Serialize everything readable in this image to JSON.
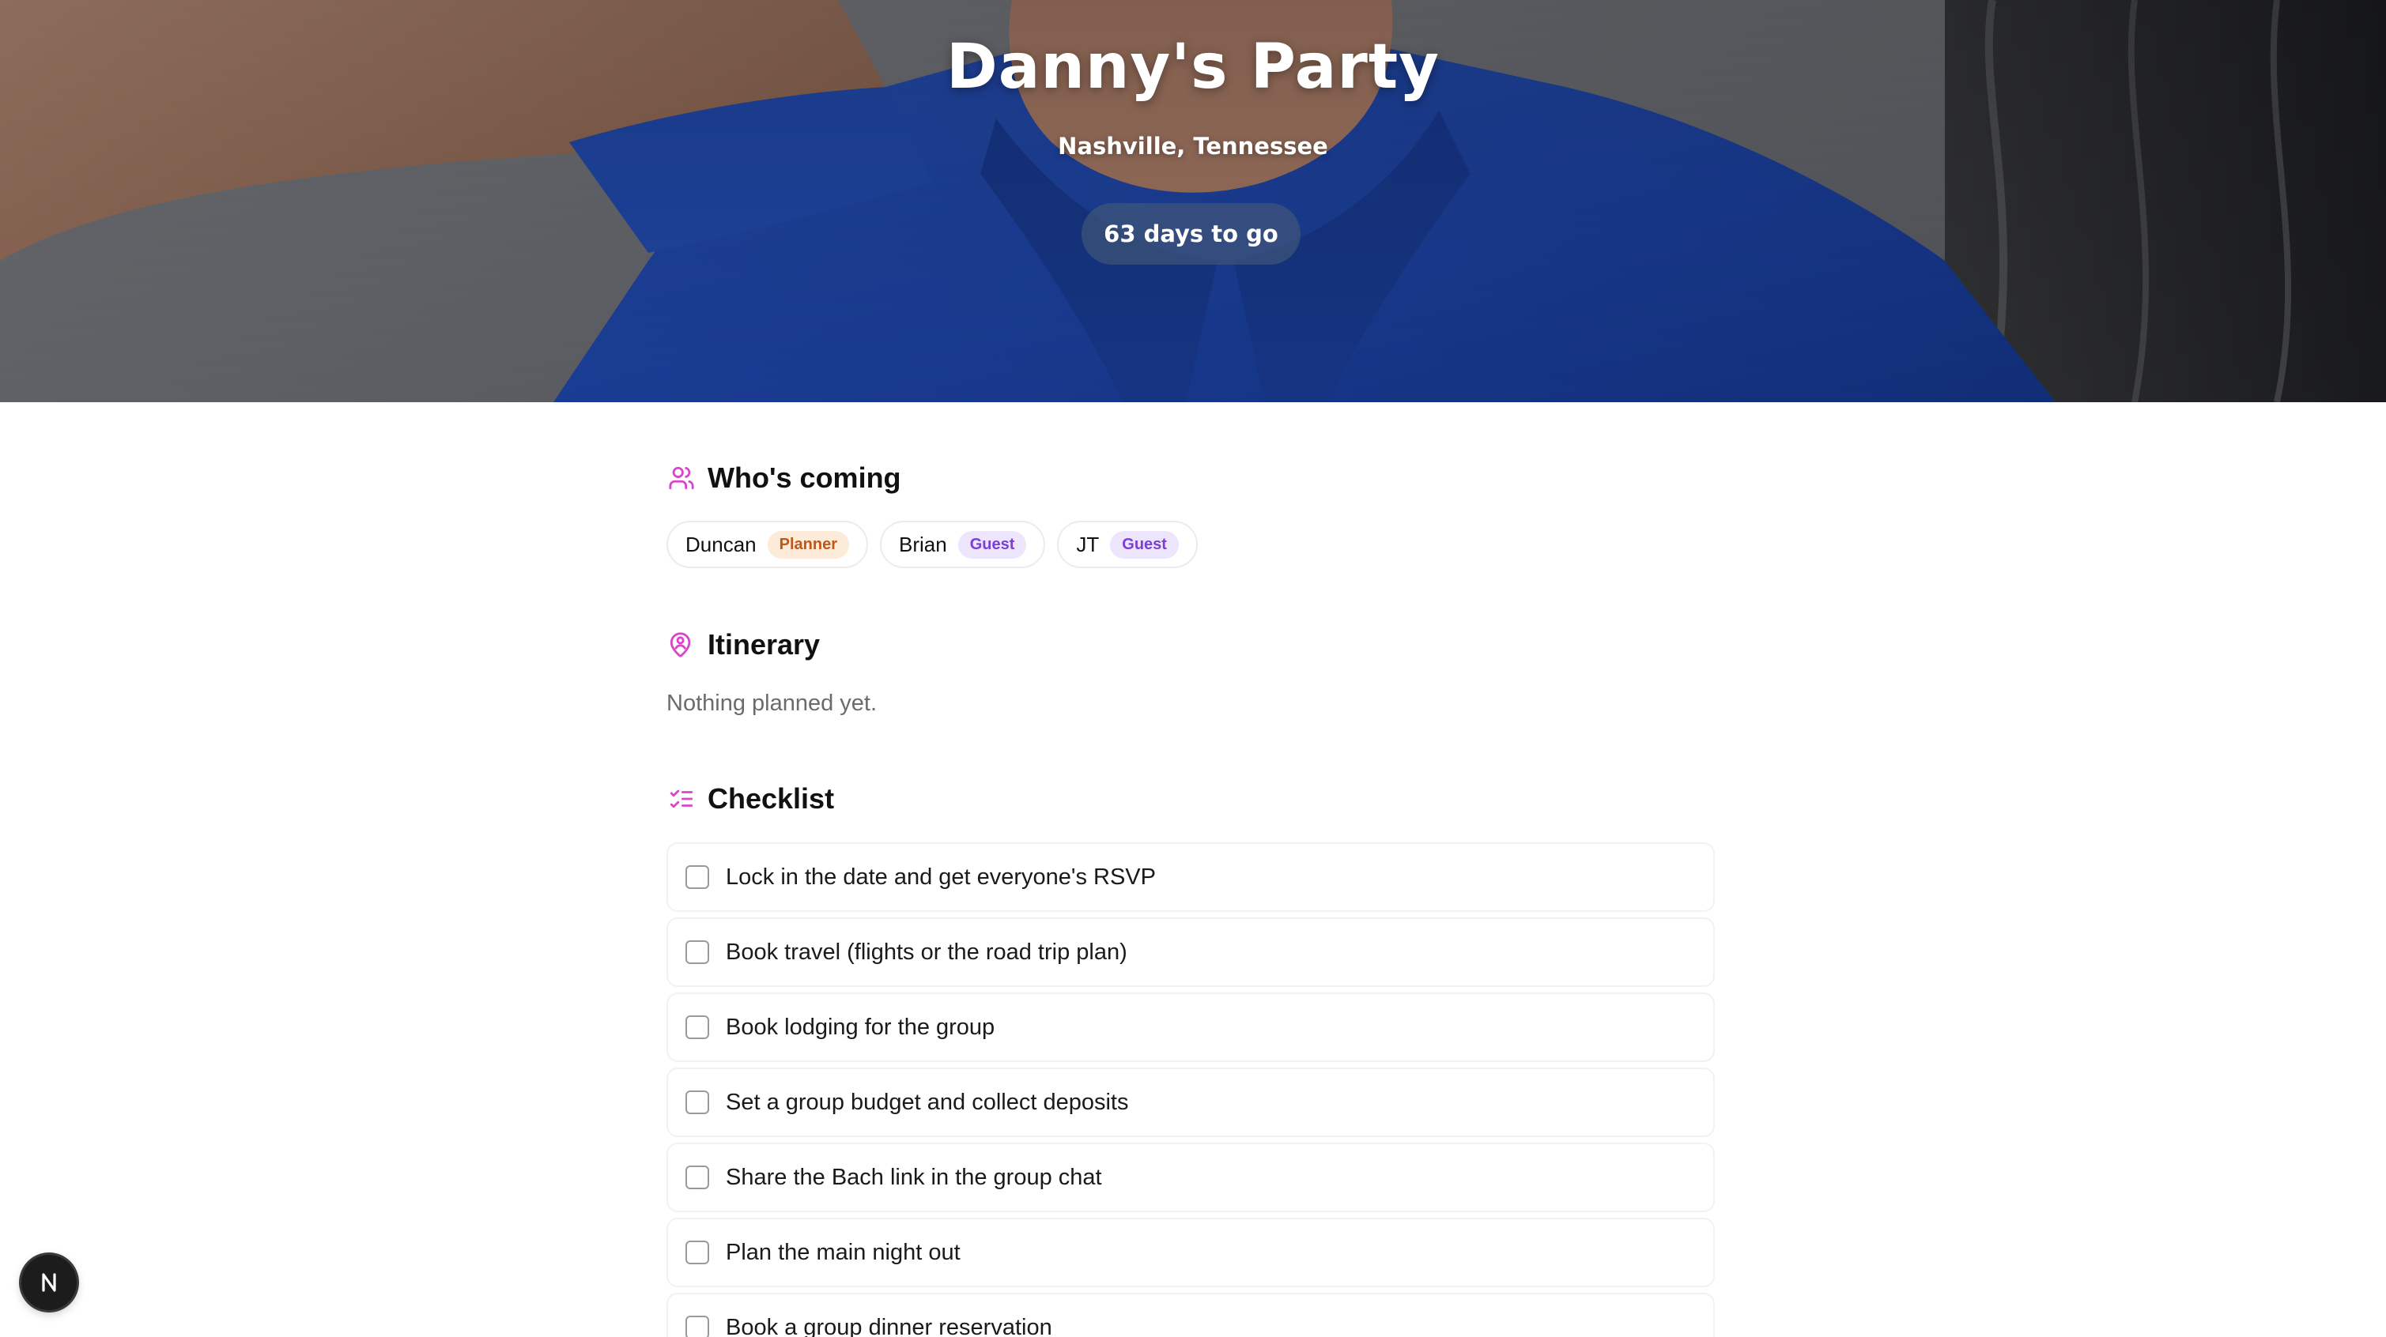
{
  "hero": {
    "title": "Danny's Party",
    "location": "Nashville, Tennessee",
    "countdown": "63 days to go"
  },
  "who": {
    "title": "Who's coming",
    "icon": "users-icon",
    "people": [
      {
        "name": "Duncan",
        "role": "Planner"
      },
      {
        "name": "Brian",
        "role": "Guest"
      },
      {
        "name": "JT",
        "role": "Guest"
      }
    ]
  },
  "itinerary": {
    "title": "Itinerary",
    "icon": "map-pin-user-icon",
    "empty_text": "Nothing planned yet."
  },
  "checklist": {
    "title": "Checklist",
    "icon": "list-checks-icon",
    "items": [
      {
        "label": "Lock in the date and get everyone's RSVP",
        "checked": false
      },
      {
        "label": "Book travel (flights or the road trip plan)",
        "checked": false
      },
      {
        "label": "Book lodging for the group",
        "checked": false
      },
      {
        "label": "Set a group budget and collect deposits",
        "checked": false
      },
      {
        "label": "Share the Bach link in the group chat",
        "checked": false
      },
      {
        "label": "Plan the main night out",
        "checked": false
      },
      {
        "label": "Book a group dinner reservation",
        "checked": false
      }
    ]
  },
  "dev_badge": {
    "label": "N",
    "icon": "nextjs-icon"
  },
  "colors": {
    "accent": "#d946c8",
    "planner_bg": "#fdebd9",
    "planner_text": "#c0561a",
    "guest_bg": "#ede5fb",
    "guest_text": "#7a3fd6"
  }
}
